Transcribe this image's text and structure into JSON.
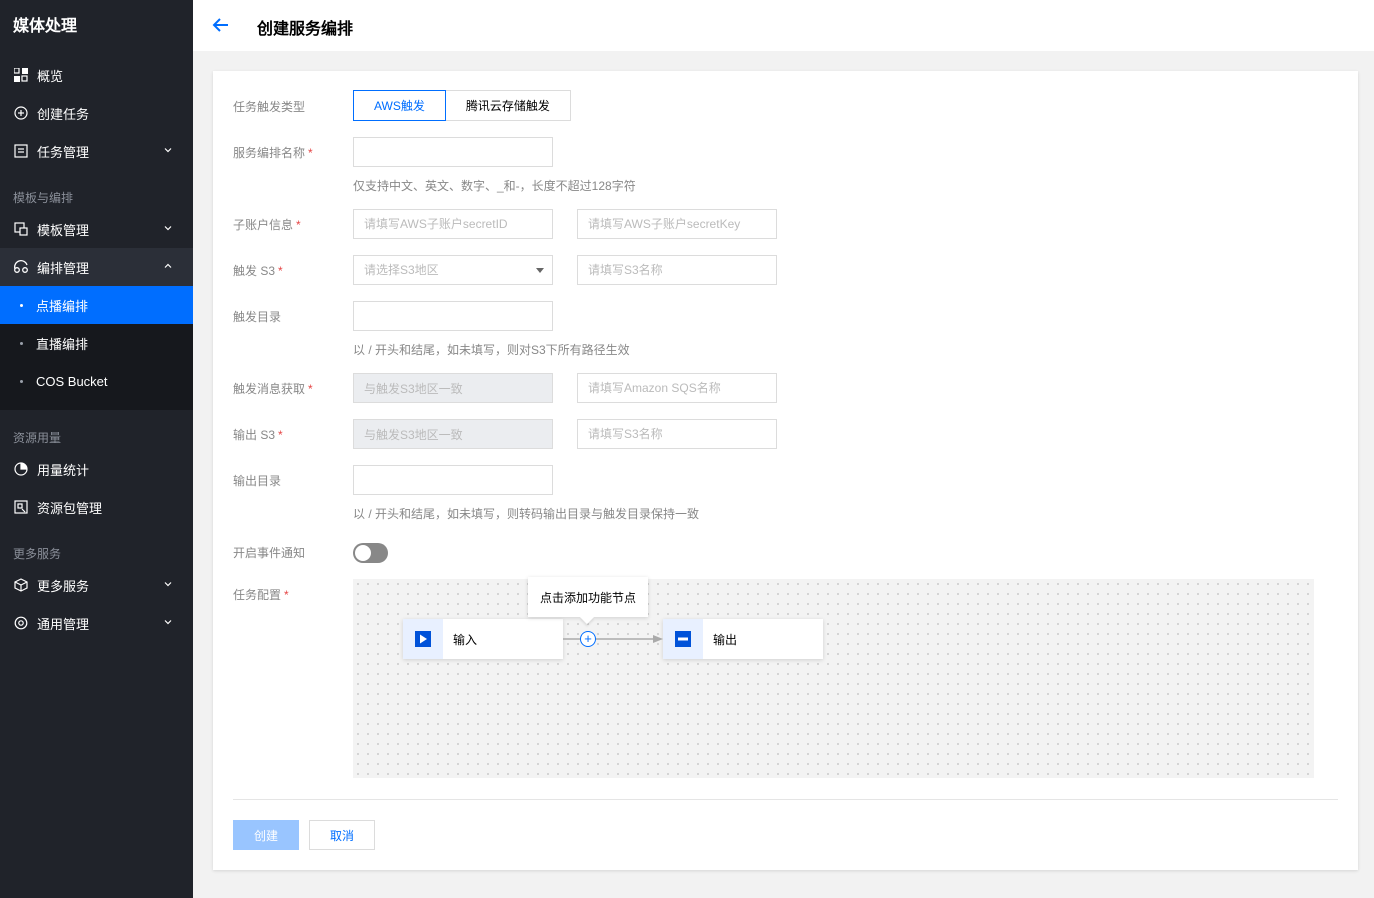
{
  "sidebar": {
    "title": "媒体处理",
    "items": {
      "overview": "概览",
      "create_task": "创建任务",
      "task_manage": "任务管理",
      "template_manage": "模板管理",
      "orchestration_manage": "编排管理",
      "usage_stats": "用量统计",
      "resource_pack": "资源包管理",
      "more_services": "更多服务",
      "general_manage": "通用管理"
    },
    "groups": {
      "templates": "模板与编排",
      "resources": "资源用量",
      "more": "更多服务"
    },
    "sub_items": {
      "vod": "点播编排",
      "live": "直播编排",
      "cos": "COS Bucket"
    }
  },
  "header": {
    "title": "创建服务编排"
  },
  "form": {
    "trigger_type": {
      "label": "任务触发类型",
      "options": [
        "AWS触发",
        "腾讯云存储触发"
      ],
      "selected": "AWS触发"
    },
    "service_name": {
      "label": "服务编排名称",
      "value": "",
      "hint": "仅支持中文、英文、数字、_和-，长度不超过128字符"
    },
    "sub_account": {
      "label": "子账户信息",
      "secret_id_placeholder": "请填写AWS子账户secretID",
      "secret_key_placeholder": "请填写AWS子账户secretKey"
    },
    "trigger_s3": {
      "label": "触发 S3",
      "region_placeholder": "请选择S3地区",
      "name_placeholder": "请填写S3名称"
    },
    "trigger_dir": {
      "label": "触发目录",
      "value": "",
      "hint": "以 / 开头和结尾，如未填写，则对S3下所有路径生效"
    },
    "trigger_msg": {
      "label": "触发消息获取",
      "region_value": "与触发S3地区一致",
      "sqs_placeholder": "请填写Amazon SQS名称"
    },
    "output_s3": {
      "label": "输出 S3",
      "region_value": "与触发S3地区一致",
      "name_placeholder": "请填写S3名称"
    },
    "output_dir": {
      "label": "输出目录",
      "value": "",
      "hint": "以 / 开头和结尾，如未填写，则转码输出目录与触发目录保持一致"
    },
    "event_notify": {
      "label": "开启事件通知",
      "enabled": false
    },
    "task_config": {
      "label": "任务配置",
      "tooltip": "点击添加功能节点",
      "input_node": "输入",
      "output_node": "输出",
      "add_symbol": "+"
    },
    "required_mark": "*"
  },
  "buttons": {
    "create": "创建",
    "cancel": "取消"
  },
  "colors": {
    "accent": "#006eff",
    "sidebar_bg": "#20232a",
    "required": "#e54545"
  }
}
